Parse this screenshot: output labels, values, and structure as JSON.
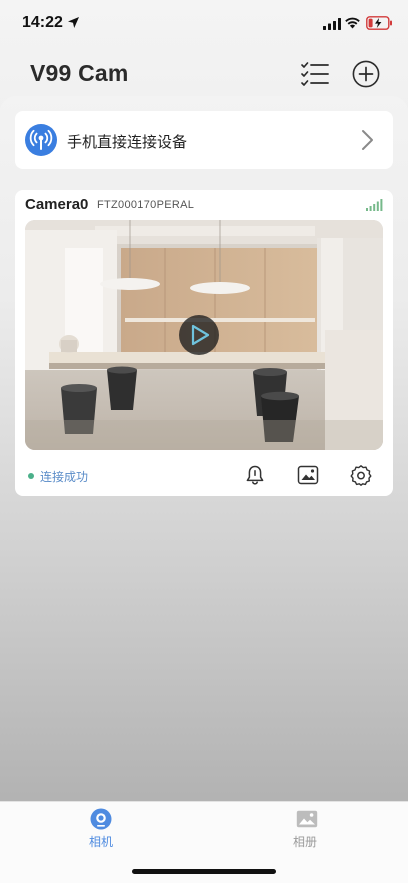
{
  "status_bar": {
    "time": "14:22"
  },
  "header": {
    "title": "V99 Cam",
    "list_icon": "checklist-icon",
    "add_icon": "plus-circle-icon"
  },
  "direct_connect": {
    "label": "手机直接连接设备",
    "icon": "signal-broadcast-icon"
  },
  "camera": {
    "name": "Camera0",
    "device_id": "FTZ000170PERAL",
    "connection_status": "连接成功"
  },
  "tabs": [
    {
      "label": "相机",
      "icon": "camera-icon",
      "active": true
    },
    {
      "label": "相册",
      "icon": "album-icon",
      "active": false
    }
  ],
  "colors": {
    "accent": "#4f8be0",
    "status_ok": "#4bb08a",
    "status_text": "#5a8cc8",
    "direct_icon_bg": "#3a7ee0"
  }
}
